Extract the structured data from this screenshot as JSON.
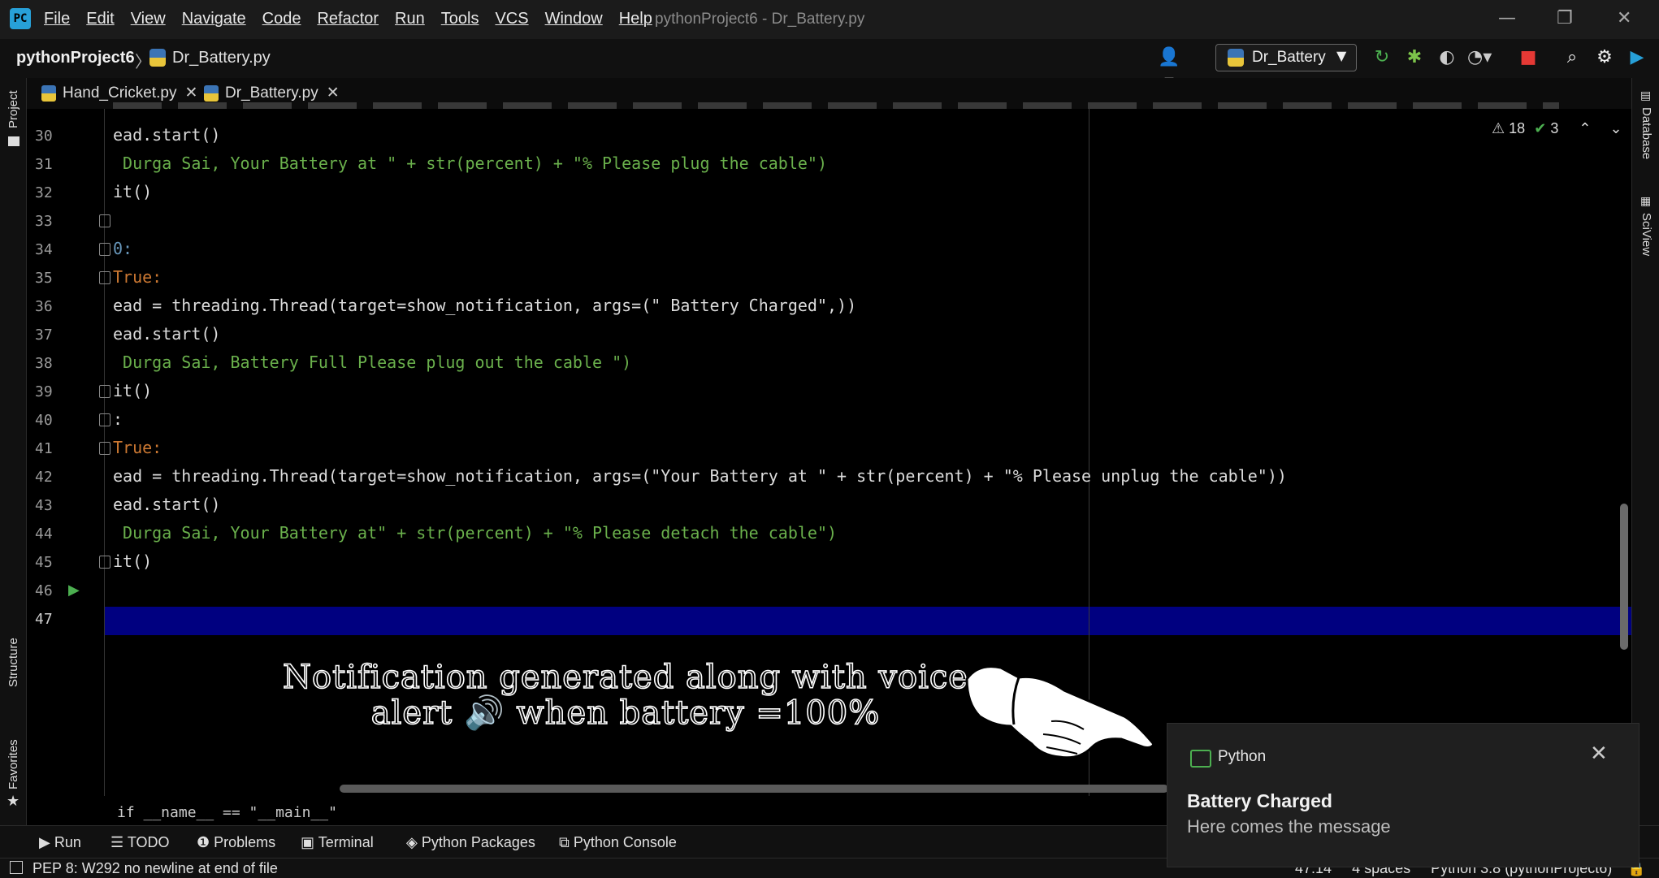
{
  "menubar": {
    "items": [
      "File",
      "Edit",
      "View",
      "Navigate",
      "Code",
      "Refactor",
      "Run",
      "Tools",
      "VCS",
      "Window",
      "Help"
    ],
    "window_title": "pythonProject6 - Dr_Battery.py"
  },
  "navbar": {
    "project": "pythonProject6",
    "file": "Dr_Battery.py",
    "run_config": "Dr_Battery"
  },
  "tabs": [
    {
      "label": "Hand_Cricket.py"
    },
    {
      "label": "Dr_Battery.py"
    }
  ],
  "side_tools": {
    "left": [
      "Project",
      "Structure",
      "Favorites"
    ],
    "right": [
      "Database",
      "SciView"
    ]
  },
  "inspections": {
    "warnings": "18",
    "ok": "3"
  },
  "code_lines": [
    {
      "n": "30",
      "text": "ead.start()"
    },
    {
      "n": "31",
      "text": " Durga Sai, Your Battery at \" + str(percent) + \"% Please plug the cable\")"
    },
    {
      "n": "32",
      "text": "it()"
    },
    {
      "n": "33",
      "text": ""
    },
    {
      "n": "34",
      "text": "0:"
    },
    {
      "n": "35",
      "text": "True:"
    },
    {
      "n": "36",
      "text": "ead = threading.Thread(target=show_notification, args=(\" Battery Charged\",))"
    },
    {
      "n": "37",
      "text": "ead.start()"
    },
    {
      "n": "38",
      "text": " Durga Sai, Battery Full Please plug out the cable \")"
    },
    {
      "n": "39",
      "text": "it()"
    },
    {
      "n": "40",
      "text": ":"
    },
    {
      "n": "41",
      "text": "True:"
    },
    {
      "n": "42",
      "text": "ead = threading.Thread(target=show_notification, args=(\"Your Battery at \" + str(percent) + \"% Please unplug the cable\"))"
    },
    {
      "n": "43",
      "text": "ead.start()"
    },
    {
      "n": "44",
      "text": " Durga Sai, Your Battery at\" + str(percent) + \"% Please detach the cable\")"
    },
    {
      "n": "45",
      "text": "it()"
    },
    {
      "n": "46",
      "text": ""
    },
    {
      "n": "47",
      "text": ""
    }
  ],
  "code_breadcrumb": "if __name__ == \"__main__\"",
  "bottom_tools": [
    "Run",
    "TODO",
    "Problems",
    "Terminal",
    "Python Packages",
    "Python Console"
  ],
  "status": {
    "message": "PEP 8: W292 no newline at end of file",
    "position": "47:14",
    "indent": "4 spaces",
    "interpreter": "Python 3.8 (pythonProject6)"
  },
  "notification": {
    "app": "Python",
    "title": "Battery Charged",
    "body": "Here comes the message"
  },
  "caption": {
    "line1": "Notification generated along with voice",
    "line2_a": "alert",
    "line2_b": "when battery =100%"
  },
  "colors": {
    "keyword": "#cc7832",
    "string": "#6ab04c",
    "builtin": "#8888c6",
    "param": "#aa4926",
    "current_line": "#000080",
    "tab_underline": "#3db8e8"
  }
}
